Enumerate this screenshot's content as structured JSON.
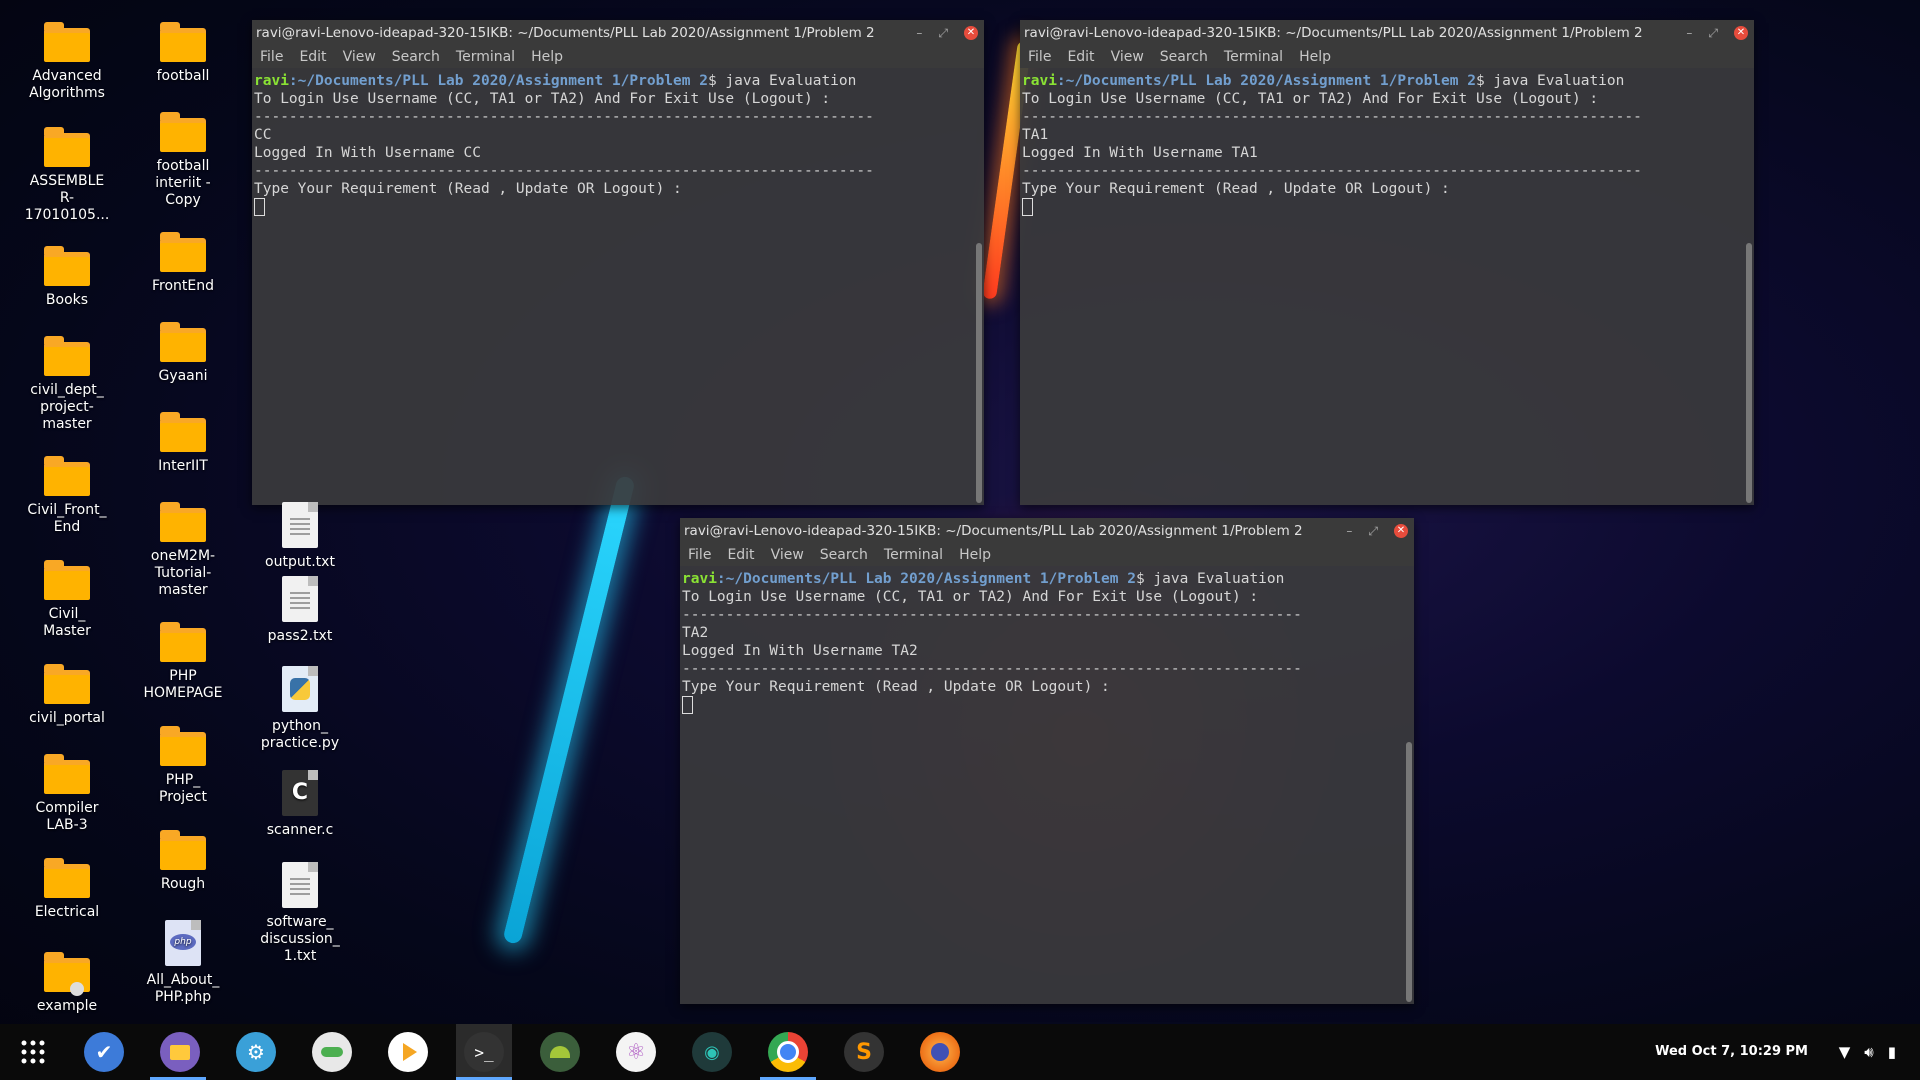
{
  "desktop": {
    "col1": [
      {
        "label": "Advanced\nAlgorithms",
        "type": "folder"
      },
      {
        "label": "ASSEMBLE\nR-\n17010105...",
        "type": "folder"
      },
      {
        "label": "Books",
        "type": "folder"
      },
      {
        "label": "civil_dept_\nproject-\nmaster",
        "type": "folder"
      },
      {
        "label": "Civil_Front_\nEnd",
        "type": "folder"
      },
      {
        "label": "Civil_\nMaster",
        "type": "folder"
      },
      {
        "label": "civil_portal",
        "type": "folder"
      },
      {
        "label": "Compiler\nLAB-3",
        "type": "folder"
      },
      {
        "label": "Electrical",
        "type": "folder"
      },
      {
        "label": "example",
        "type": "folder-locked"
      }
    ],
    "col2": [
      {
        "label": "football",
        "type": "folder"
      },
      {
        "label": "football\ninteriit -\nCopy",
        "type": "folder"
      },
      {
        "label": "FrontEnd",
        "type": "folder"
      },
      {
        "label": "Gyaani",
        "type": "folder"
      },
      {
        "label": "InterIIT",
        "type": "folder"
      },
      {
        "label": "oneM2M-\nTutorial-\nmaster",
        "type": "folder"
      },
      {
        "label": "PHP\nHOMEPAGE",
        "type": "folder"
      },
      {
        "label": "PHP_\nProject",
        "type": "folder"
      },
      {
        "label": "Rough",
        "type": "folder"
      },
      {
        "label": "All_About_\nPHP.php",
        "type": "php"
      }
    ],
    "col3": [
      {
        "label": "output.txt",
        "type": "text"
      },
      {
        "label": "pass2.txt",
        "type": "text"
      },
      {
        "label": "python_\npractice.py",
        "type": "python"
      },
      {
        "label": "scanner.c",
        "type": "c"
      },
      {
        "label": "software_\ndiscussion_\n1.txt",
        "type": "text"
      }
    ]
  },
  "terminal_menu": [
    "File",
    "Edit",
    "View",
    "Search",
    "Terminal",
    "Help"
  ],
  "terminals": [
    {
      "title": "ravi@ravi-Lenovo-ideapad-320-15IKB: ~/Documents/PLL Lab 2020/Assignment 1/Problem 2",
      "prompt_user": "ravi",
      "prompt_path": ":~/Documents/PLL Lab 2020/Assignment 1/Problem 2",
      "command": "$ java Evaluation",
      "line1": "To Login Use Username (CC, TA1 or TA2) And For Exit Use (Logout) :",
      "sep": "-----------------------------------------------------------------------",
      "input": "CC",
      "logged": "Logged In With Username CC",
      "sep2": "-----------------------------------------------------------------------",
      "req": "Type Your Requirement (Read , Update OR Logout) :"
    },
    {
      "title": "ravi@ravi-Lenovo-ideapad-320-15IKB: ~/Documents/PLL Lab 2020/Assignment 1/Problem 2",
      "prompt_user": "ravi",
      "prompt_path": ":~/Documents/PLL Lab 2020/Assignment 1/Problem 2",
      "command": "$ java Evaluation",
      "line1": "To Login Use Username (CC, TA1 or TA2) And For Exit Use (Logout) :",
      "sep": "-----------------------------------------------------------------------",
      "input": "TA1",
      "logged": "Logged In With Username TA1",
      "sep2": "-----------------------------------------------------------------------",
      "req": "Type Your Requirement (Read , Update OR Logout) :"
    },
    {
      "title": "ravi@ravi-Lenovo-ideapad-320-15IKB: ~/Documents/PLL Lab 2020/Assignment 1/Problem 2",
      "prompt_user": "ravi",
      "prompt_path": ":~/Documents/PLL Lab 2020/Assignment 1/Problem 2",
      "command": "$ java Evaluation",
      "line1": "To Login Use Username (CC, TA1 or TA2) And For Exit Use (Logout) :",
      "sep": "-----------------------------------------------------------------------",
      "input": "TA2",
      "logged": "Logged In With Username TA2",
      "sep2": "-----------------------------------------------------------------------",
      "req": "Type Your Requirement (Read , Update OR Logout) :"
    }
  ],
  "taskbar": {
    "apps": [
      "app-launcher-icon",
      "tasks-check-icon",
      "files-icon",
      "settings-icon",
      "toggle-app-icon",
      "media-player-icon",
      "terminal-icon",
      "android-studio-icon",
      "atom-icon",
      "gitkraken-icon",
      "chrome-icon",
      "sublime-text-icon",
      "firefox-icon"
    ],
    "clock": "Wed Oct  7, 10:29 PM"
  },
  "colors": {
    "accent": "#5fa8ff",
    "prompt_user": "#8ae234",
    "prompt_path": "#729fcf",
    "folder": "#ffb300",
    "close": "#e74c3c"
  }
}
